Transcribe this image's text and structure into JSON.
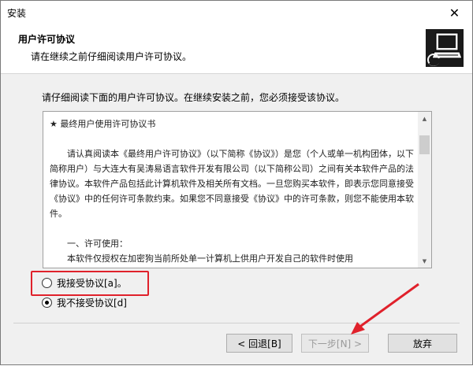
{
  "window": {
    "title": "安装",
    "close_glyph": "✕"
  },
  "header": {
    "title": "用户许可协议",
    "subtitle": "请在继续之前仔细阅读用户许可协议。",
    "logo_icon": "computer-install-icon"
  },
  "instruction": "请仔细阅读下面的用户许可协议。在继续安装之前，您必须接受该协议。",
  "license": {
    "heading": "★ 最终用户使用许可协议书",
    "paragraph1": "请认真阅读本《最终用户许可协议》（以下简称《协议》）是您（个人或单一机构团体，以下简称用户）与大连大有吴涛易语言软件开发有限公司（以下简称公司）之间有关本软件产品的法律协议。本软件产品包括此计算机软件及相关所有文档。一旦您购买本软件，即表示您同意接受《协议》中的任何许可条款约束。如果您不同意接受《协议》中的许可条款，则您不能使用本软件。",
    "section1_title": "一、许可使用：",
    "section1_text": "本软件仅授权在加密狗当前所处单一计算机上供用户开发自己的软件时使用"
  },
  "radios": {
    "accept": {
      "label": "我接受协议[a]。",
      "checked": false
    },
    "decline": {
      "label": "我不接受协议[d]",
      "checked": true
    }
  },
  "buttons": {
    "back": "< 回退[B]",
    "next": "下一步[N] >",
    "cancel": "放弃"
  },
  "colors": {
    "highlight": "#e0212b"
  }
}
